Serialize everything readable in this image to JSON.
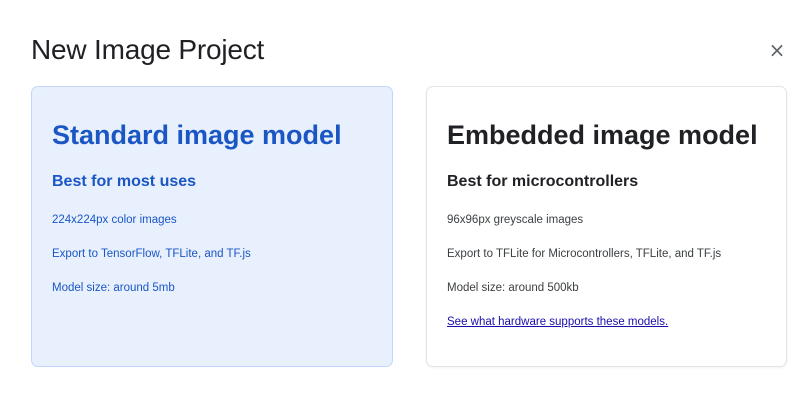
{
  "dialog": {
    "title": "New Image Project",
    "close_label": "×"
  },
  "cards": {
    "standard": {
      "title": "Standard image model",
      "subtitle": "Best for most uses",
      "lines": [
        "224x224px color images",
        "Export to TensorFlow, TFLite, and TF.js",
        "Model size: around 5mb"
      ]
    },
    "embedded": {
      "title": "Embedded image model",
      "subtitle": "Best for microcontrollers",
      "lines": [
        "96x96px greyscale images",
        "Export to TFLite for Microcontrollers, TFLite, and TF.js",
        "Model size: around 500kb"
      ],
      "link": "See what hardware supports these models."
    }
  },
  "colors": {
    "accent_blue": "#1a56c4",
    "selected_card_bg": "#e8f0fe",
    "link": "#1a0dab"
  },
  "icons": {
    "close": "close-icon"
  }
}
